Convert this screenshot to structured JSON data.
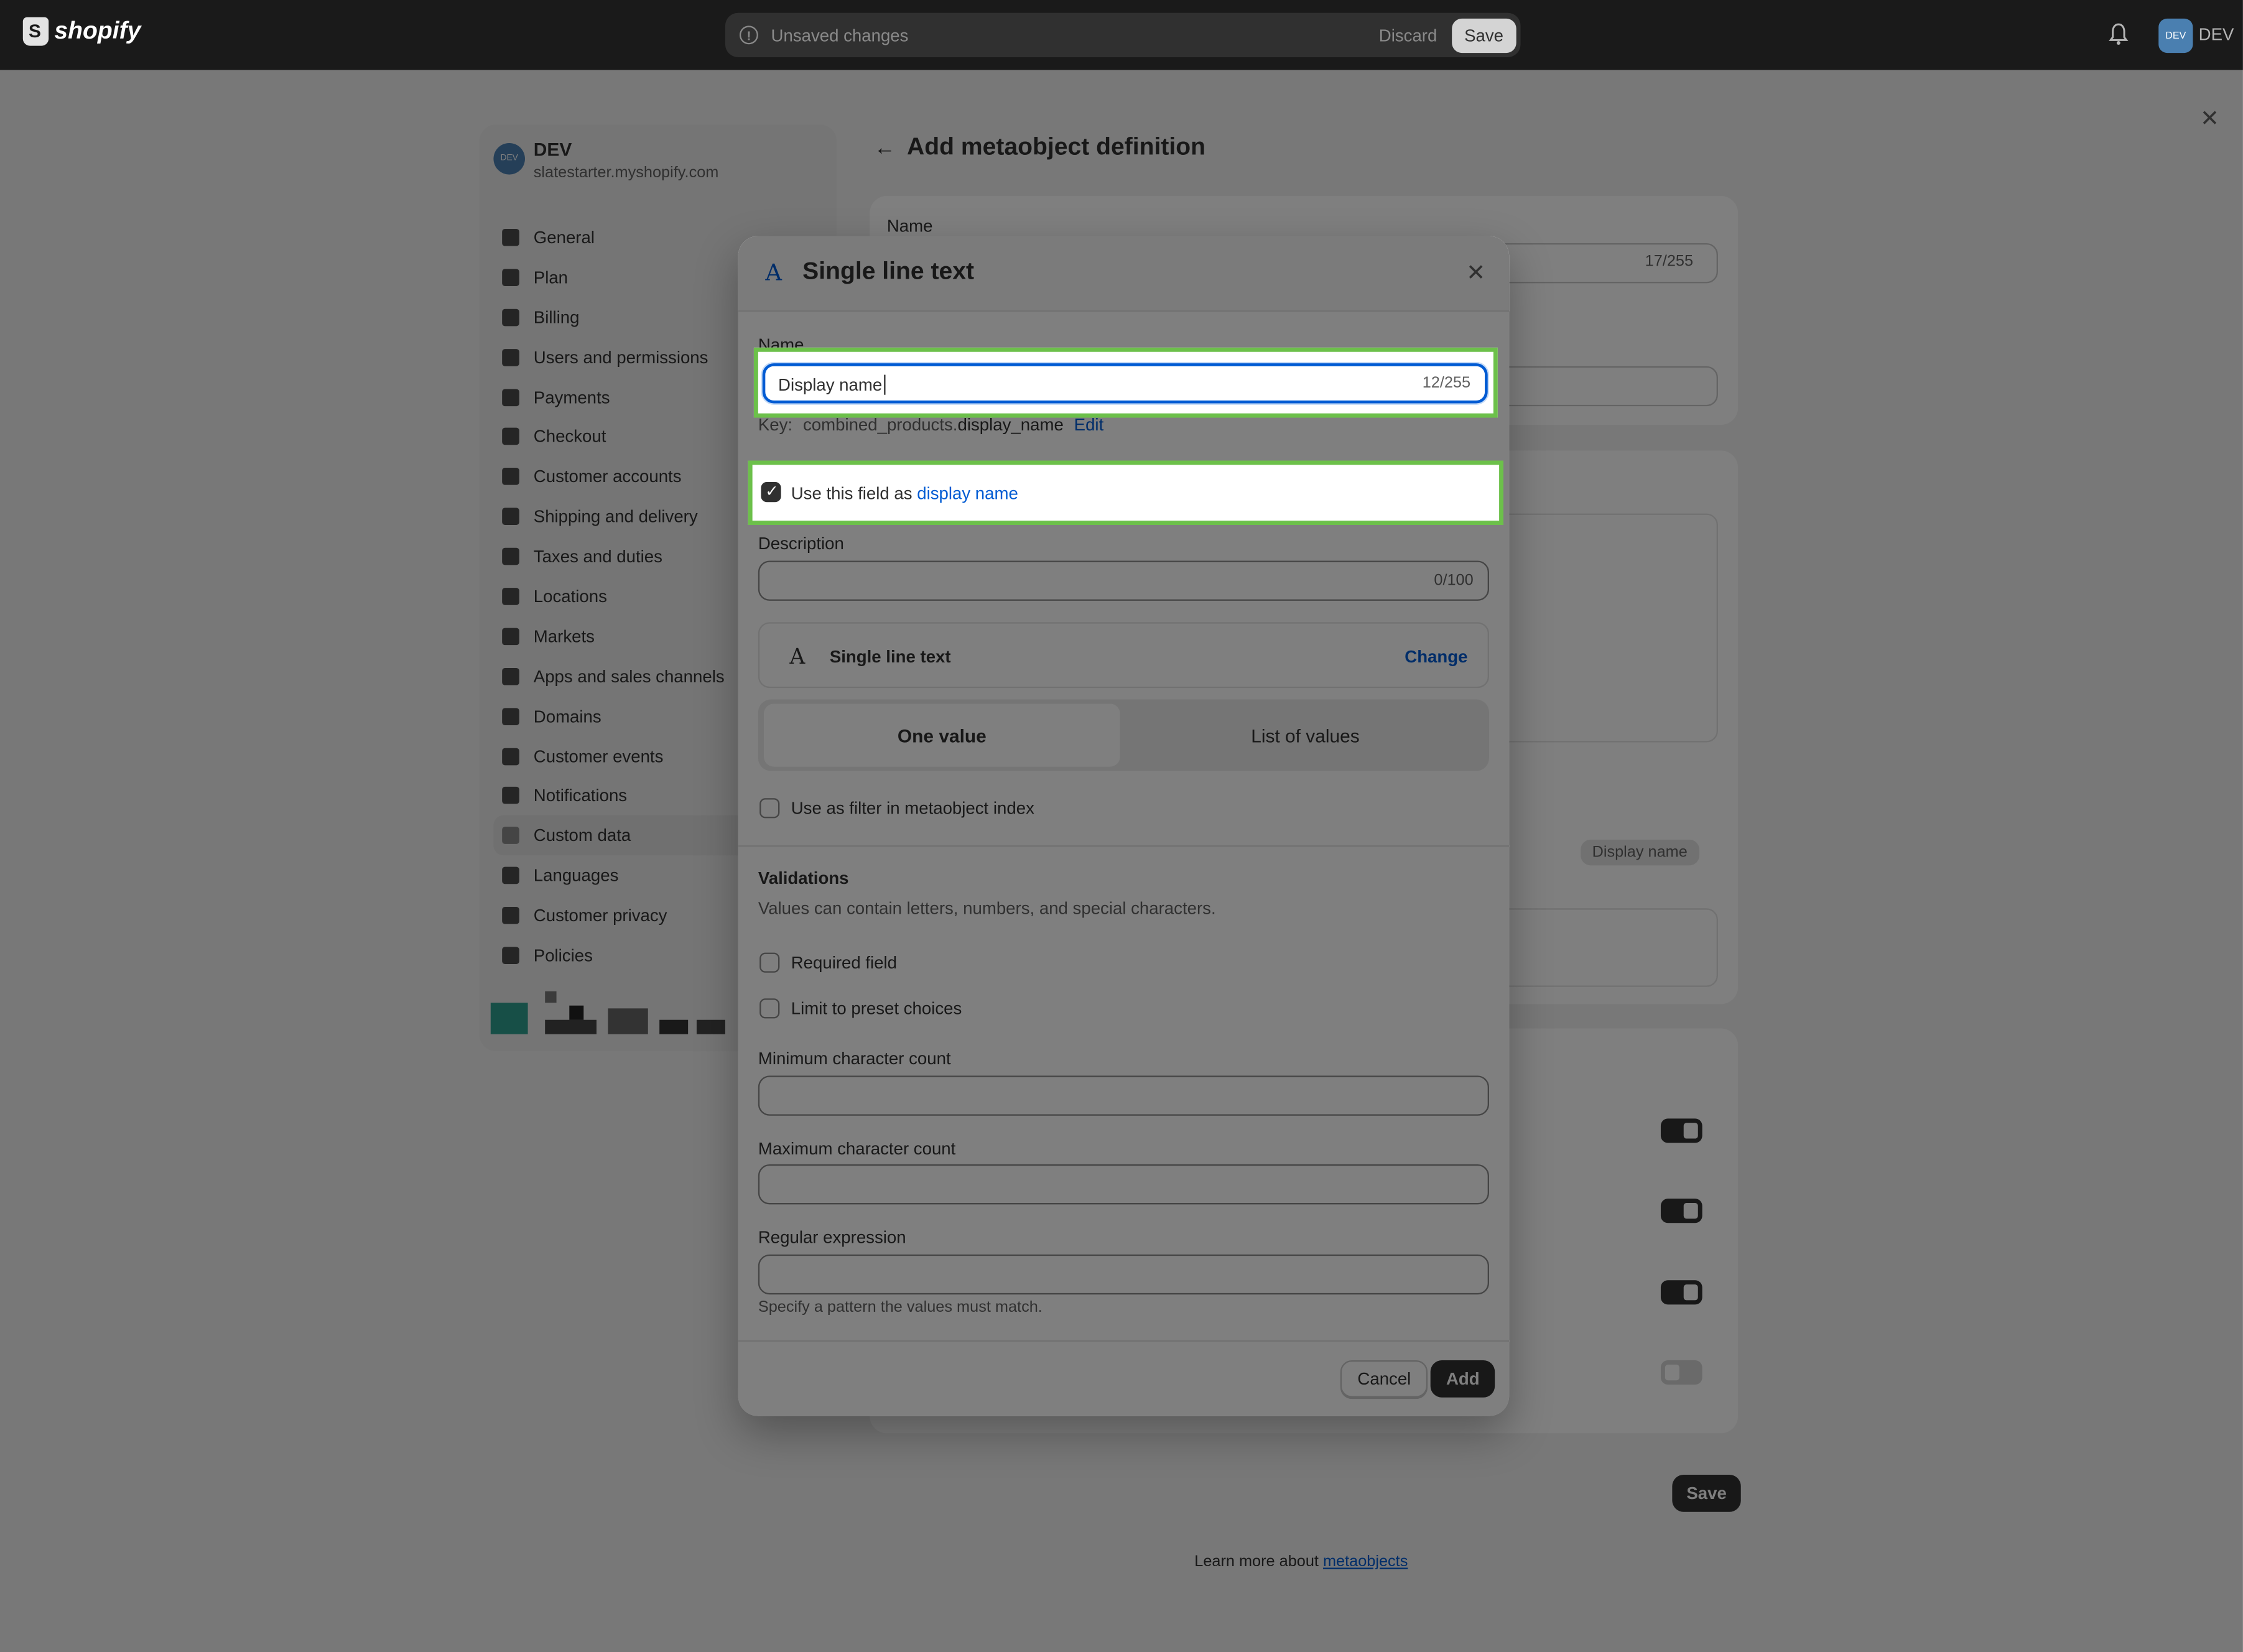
{
  "topbar": {
    "brand": "shopify",
    "unsaved_text": "Unsaved changes",
    "discard_label": "Discard",
    "save_label": "Save",
    "avatar_initials": "DEV",
    "store_label": "DEV"
  },
  "sidebar": {
    "store_avatar": "DEV",
    "store_name": "DEV",
    "store_domain": "slatestarter.myshopify.com",
    "items": [
      {
        "label": "General",
        "icon": "store-icon"
      },
      {
        "label": "Plan",
        "icon": "plan-icon"
      },
      {
        "label": "Billing",
        "icon": "billing-icon"
      },
      {
        "label": "Users and permissions",
        "icon": "users-icon"
      },
      {
        "label": "Payments",
        "icon": "payments-icon"
      },
      {
        "label": "Checkout",
        "icon": "cart-icon"
      },
      {
        "label": "Customer accounts",
        "icon": "person-icon"
      },
      {
        "label": "Shipping and delivery",
        "icon": "truck-icon"
      },
      {
        "label": "Taxes and duties",
        "icon": "tax-icon"
      },
      {
        "label": "Locations",
        "icon": "location-icon"
      },
      {
        "label": "Markets",
        "icon": "globe-icon"
      },
      {
        "label": "Apps and sales channels",
        "icon": "apps-icon"
      },
      {
        "label": "Domains",
        "icon": "domains-icon"
      },
      {
        "label": "Customer events",
        "icon": "events-icon"
      },
      {
        "label": "Notifications",
        "icon": "bell-icon"
      },
      {
        "label": "Custom data",
        "icon": "database-icon",
        "active": true
      },
      {
        "label": "Languages",
        "icon": "language-icon"
      },
      {
        "label": "Customer privacy",
        "icon": "lock-icon"
      },
      {
        "label": "Policies",
        "icon": "policy-icon"
      }
    ]
  },
  "page": {
    "title": "Add metaobject definition",
    "name_label": "Name",
    "name_count": "17/255",
    "display_pill": "Display name",
    "save_label": "Save",
    "learn_more_prefix": "Learn more about ",
    "learn_more_link": "metaobjects",
    "toggles": [
      true,
      true,
      true,
      false
    ]
  },
  "modal": {
    "title": "Single line text",
    "name_label": "Name",
    "name_value": "Display name",
    "name_count": "12/255",
    "key_prefix": "Key:",
    "key_namespace": "combined_products.",
    "key_name": "display_name",
    "key_edit": "Edit",
    "display_checkbox_prefix": "Use this field as ",
    "display_checkbox_link": "display name",
    "display_checked": true,
    "description_label": "Description",
    "description_count": "0/100",
    "type_name": "Single line text",
    "type_change": "Change",
    "seg_one": "One value",
    "seg_list": "List of values",
    "filter_label": "Use as filter in metaobject index",
    "validations_title": "Validations",
    "validations_desc": "Values can contain letters, numbers, and special characters.",
    "required_label": "Required field",
    "preset_label": "Limit to preset choices",
    "min_label": "Minimum character count",
    "max_label": "Maximum character count",
    "regex_label": "Regular expression",
    "regex_hint": "Specify a pattern the values must match.",
    "cancel_label": "Cancel",
    "add_label": "Add"
  },
  "colors": {
    "accent": "#005bd3",
    "highlight": "#6cc04a",
    "primary_button": "#303030"
  }
}
